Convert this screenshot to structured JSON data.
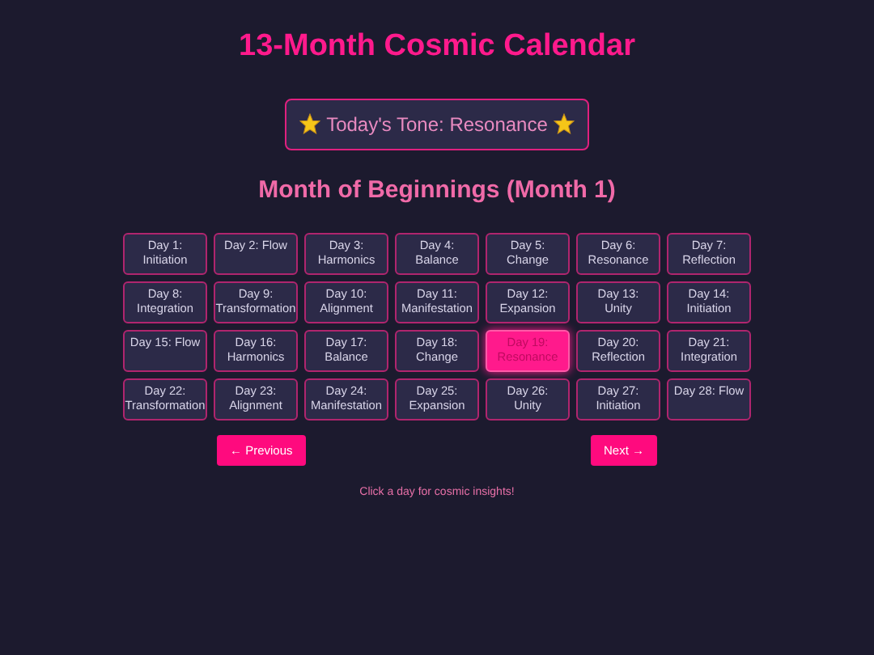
{
  "title": "13-Month Cosmic Calendar",
  "tone": "Today's Tone: Resonance",
  "month_title": "Month of Beginnings (Month 1)",
  "days": [
    {
      "label": "Day 1: Initiation",
      "selected": false
    },
    {
      "label": "Day 2: Flow",
      "selected": false
    },
    {
      "label": "Day 3: Harmonics",
      "selected": false
    },
    {
      "label": "Day 4: Balance",
      "selected": false
    },
    {
      "label": "Day 5: Change",
      "selected": false
    },
    {
      "label": "Day 6: Resonance",
      "selected": false
    },
    {
      "label": "Day 7: Reflection",
      "selected": false
    },
    {
      "label": "Day 8: Integration",
      "selected": false
    },
    {
      "label": "Day 9: Transformation",
      "selected": false
    },
    {
      "label": "Day 10: Alignment",
      "selected": false
    },
    {
      "label": "Day 11: Manifestation",
      "selected": false
    },
    {
      "label": "Day 12: Expansion",
      "selected": false
    },
    {
      "label": "Day 13: Unity",
      "selected": false
    },
    {
      "label": "Day 14: Initiation",
      "selected": false
    },
    {
      "label": "Day 15: Flow",
      "selected": false
    },
    {
      "label": "Day 16: Harmonics",
      "selected": false
    },
    {
      "label": "Day 17: Balance",
      "selected": false
    },
    {
      "label": "Day 18: Change",
      "selected": false
    },
    {
      "label": "Day 19: Resonance",
      "selected": true
    },
    {
      "label": "Day 20: Reflection",
      "selected": false
    },
    {
      "label": "Day 21: Integration",
      "selected": false
    },
    {
      "label": "Day 22: Transformation",
      "selected": false
    },
    {
      "label": "Day 23: Alignment",
      "selected": false
    },
    {
      "label": "Day 24: Manifestation",
      "selected": false
    },
    {
      "label": "Day 25: Expansion",
      "selected": false
    },
    {
      "label": "Day 26: Unity",
      "selected": false
    },
    {
      "label": "Day 27: Initiation",
      "selected": false
    },
    {
      "label": "Day 28: Flow",
      "selected": false
    }
  ],
  "prev_button": "← Previous",
  "next_button": "Next →",
  "hint": "Click a day for cosmic insights!"
}
